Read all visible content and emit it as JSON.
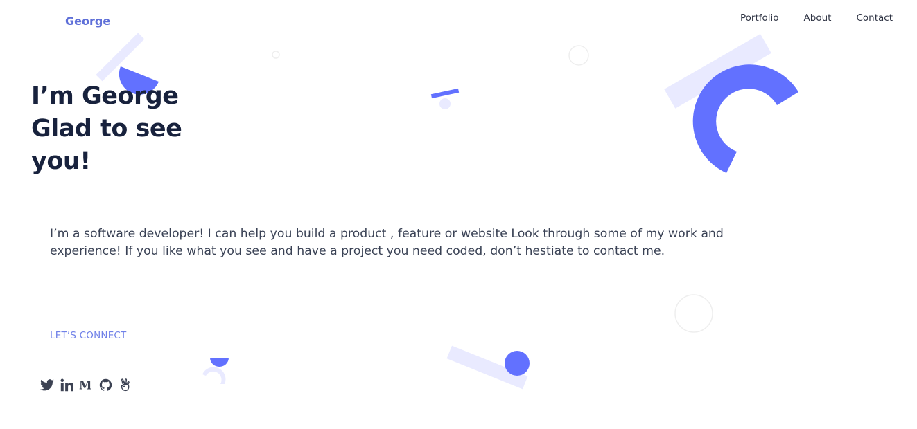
{
  "header": {
    "logo": "George",
    "nav": [
      "Portfolio",
      "About",
      "Contact"
    ]
  },
  "hero": {
    "title_lines": [
      "I’m George",
      "Glad to see",
      "you!"
    ],
    "intro": "I’m a software developer! I can help you build a product , feature or website Look through some of my work and experience! If you like what you see and have a project you need coded, don’t hestiate to contact me."
  },
  "connect": {
    "label": "LET’S CONNECT",
    "socials": [
      "twitter-icon",
      "linkedin-icon",
      "medium-icon",
      "github-icon",
      "angellist-icon"
    ]
  },
  "colors": {
    "accent": "#6271ff",
    "accent_light": "#e9eaff",
    "heading": "#18223d",
    "body_text": "#3a4255",
    "logo": "#5e6fd8",
    "connect_label": "#7081e8"
  }
}
